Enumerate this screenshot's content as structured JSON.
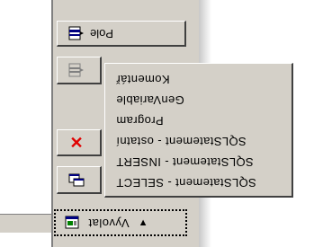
{
  "toolbar": {
    "pole_label": "Pole",
    "vyvolat_label": "Vyvolat",
    "vyvolat_arrow": "▲"
  },
  "menu": {
    "items": [
      "Komentář",
      "GenVariable",
      "Program",
      "SQLStatement - ostatní",
      "SQLStatement - INSERT",
      "SQLStatement - SELECT"
    ]
  },
  "icons": {
    "pole": "field-icon",
    "second": "field-disabled-icon",
    "delete": "delete-x-icon",
    "fourth": "window-icon",
    "vyvolat": "invoke-icon"
  },
  "colors": {
    "panel": "#d4d0c8",
    "delete_x": "#e00000"
  }
}
